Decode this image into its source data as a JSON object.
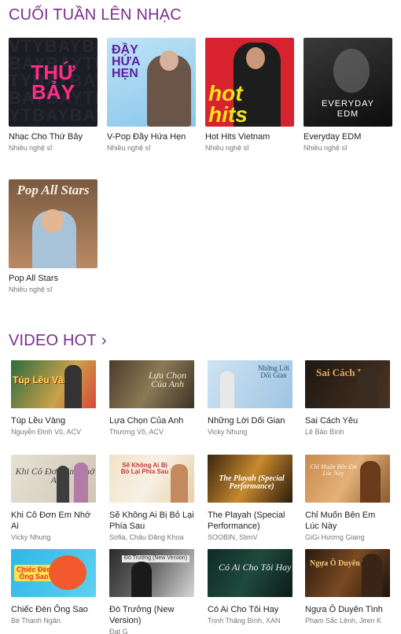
{
  "weekend": {
    "title": "CUỐI TUẦN LÊN NHẠC",
    "playlists": [
      {
        "title": "Nhạc Cho Thứ Bảy",
        "subtitle": "Nhiều nghệ sĩ",
        "art_text": "THỨ BẢY"
      },
      {
        "title": "V-Pop Đầy Hứa Hẹn",
        "subtitle": "Nhiều nghệ sĩ",
        "art_text": "ĐẦY HỨA HẸN"
      },
      {
        "title": "Hot Hits Vietnam",
        "subtitle": "Nhiều nghệ sĩ",
        "art_text": "hot hits"
      },
      {
        "title": "Everyday EDM",
        "subtitle": "Nhiều nghệ sĩ",
        "art_text": "EVERYDAY EDM"
      },
      {
        "title": "Pop All Stars",
        "subtitle": "Nhiều nghệ sĩ",
        "art_text": "Pop All Stars"
      }
    ]
  },
  "videos": {
    "title": "VIDEO HOT",
    "items": [
      {
        "title": "Túp Lều Vàng",
        "subtitle": "Nguyễn Đình Vũ, ACV"
      },
      {
        "title": "Lựa Chọn Của Anh",
        "subtitle": "Thương Võ, ACV"
      },
      {
        "title": "Những Lời Dối Gian",
        "subtitle": "Vicky Nhung"
      },
      {
        "title": "Sai Cách Yêu",
        "subtitle": "Lê Bảo Bình"
      },
      {
        "title": "Khi Cô Đơn Em Nhớ Ai",
        "subtitle": "Vicky Nhung"
      },
      {
        "title": "Sẽ Không Ai Bị Bỏ Lại Phía Sau",
        "subtitle": "Sofia, Châu Đăng Khoa"
      },
      {
        "title": "The Playah (Special Performance)",
        "subtitle": "SOOBIN, SlimV"
      },
      {
        "title": "Chỉ Muốn Bên Em Lúc Này",
        "subtitle": "GiGi Hương Giang"
      },
      {
        "title": "Chiếc Đèn Ông Sao",
        "subtitle": "Bé Thanh Ngân"
      },
      {
        "title": "Đò Trưởng (New Version)",
        "subtitle": "Đạt G"
      },
      {
        "title": "Có Ai Cho Tôi Hay",
        "subtitle": "Trịnh Thăng Bình, XAN"
      },
      {
        "title": "Ngựa Ô Duyên Tình",
        "subtitle": "Phạm Sắc Lệnh, Jiren K"
      }
    ]
  }
}
